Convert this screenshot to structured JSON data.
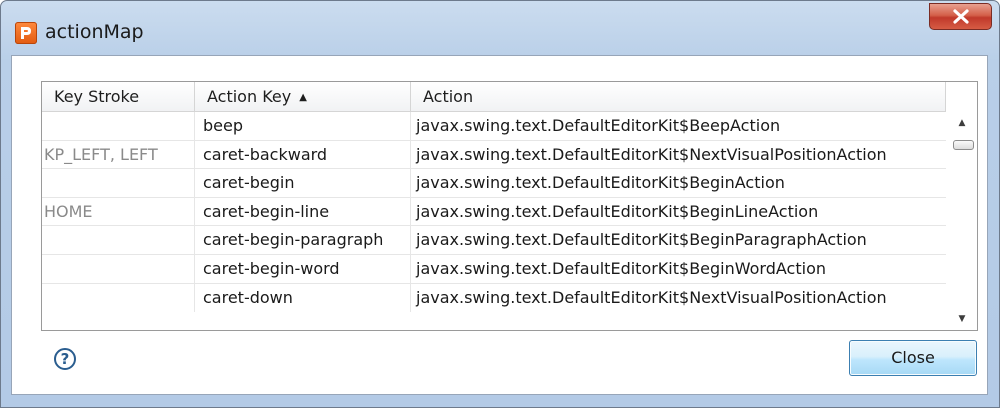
{
  "window": {
    "title": "actionMap"
  },
  "table": {
    "columns": [
      {
        "label": "Key Stroke"
      },
      {
        "label": "Action Key",
        "sort": "▲"
      },
      {
        "label": "Action"
      }
    ],
    "rows": [
      {
        "key_stroke": "",
        "action_key": "beep",
        "action": "javax.swing.text.DefaultEditorKit$BeepAction"
      },
      {
        "key_stroke": "KP_LEFT, LEFT",
        "action_key": "caret-backward",
        "action": "javax.swing.text.DefaultEditorKit$NextVisualPositionAction"
      },
      {
        "key_stroke": "",
        "action_key": "caret-begin",
        "action": "javax.swing.text.DefaultEditorKit$BeginAction"
      },
      {
        "key_stroke": "HOME",
        "action_key": "caret-begin-line",
        "action": "javax.swing.text.DefaultEditorKit$BeginLineAction"
      },
      {
        "key_stroke": "",
        "action_key": "caret-begin-paragraph",
        "action": "javax.swing.text.DefaultEditorKit$BeginParagraphAction"
      },
      {
        "key_stroke": "",
        "action_key": "caret-begin-word",
        "action": "javax.swing.text.DefaultEditorKit$BeginWordAction"
      },
      {
        "key_stroke": "",
        "action_key": "caret-down",
        "action": "javax.swing.text.DefaultEditorKit$NextVisualPositionAction"
      }
    ]
  },
  "scrollbar": {
    "up_glyph": "▲",
    "down_glyph": "▼"
  },
  "footer": {
    "help_glyph": "?",
    "close_label": "Close"
  },
  "icons": {
    "app": "app-logo-icon",
    "close": "close-icon",
    "help": "help-icon"
  },
  "colors": {
    "accent": "#3c7fb1",
    "close_red": "#c0392b",
    "app_orange": "#e25a10"
  }
}
